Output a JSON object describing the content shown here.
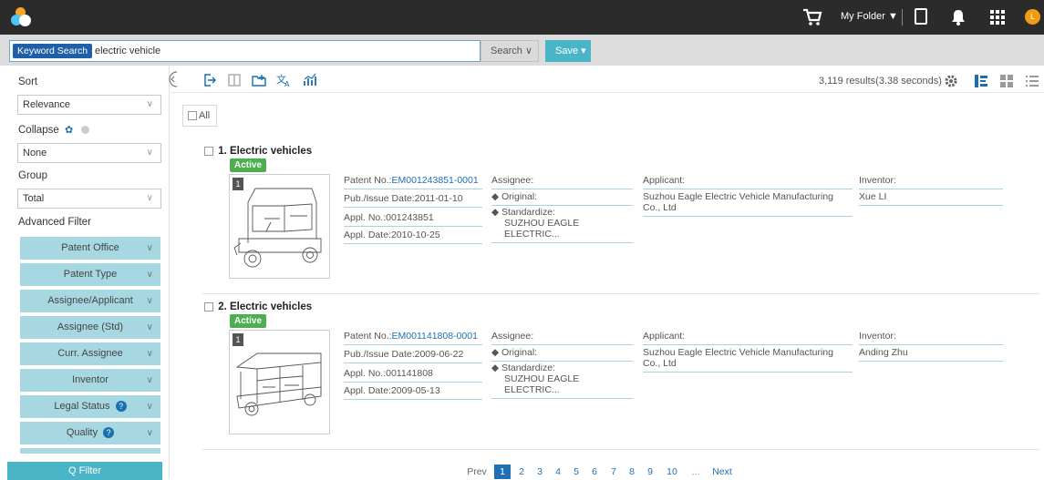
{
  "header": {
    "folder_label": "My Folder ▼",
    "avatar_letter": "L"
  },
  "search": {
    "tag": "Keyword Search",
    "query": "electric vehicle",
    "search_button": "Search ∨",
    "save_button": "Save ▾"
  },
  "sidebar": {
    "sort_label": "Sort",
    "sort_value": "Relevance",
    "collapse_label": "Collapse",
    "collapse_value": "None",
    "group_label": "Group",
    "group_value": "Total",
    "advanced_label": "Advanced Filter",
    "filters": [
      {
        "label": "Patent Office"
      },
      {
        "label": "Patent Type"
      },
      {
        "label": "Assignee/Applicant"
      },
      {
        "label": "Assignee (Std)"
      },
      {
        "label": "Curr. Assignee"
      },
      {
        "label": "Inventor"
      },
      {
        "label": "Legal Status"
      },
      {
        "label": "Quality"
      }
    ],
    "filter_button": "Q Filter"
  },
  "toolbar": {
    "results_text": "3,119 results(3.38 seconds)"
  },
  "content": {
    "all_label": "All",
    "results": [
      {
        "title": "1. Electric vehicles",
        "status": "Active",
        "image_index": "1",
        "patent_no_label": "Patent No.:",
        "patent_no": "EM001243851-0001",
        "pub_date": "Pub./Issue Date:2011-01-10",
        "appl_no": "Appl. No.:001243851",
        "appl_date": "Appl. Date:2010-10-25",
        "assignee_label": "Assignee:",
        "original_label": "◆ Original:",
        "standardize_label": "◆ Standardize:",
        "standardize_value": "SUZHOU EAGLE ELECTRIC...",
        "applicant_label": "Applicant:",
        "applicant_value": "Suzhou Eagle Electric Vehicle Manufacturing Co., Ltd",
        "inventor_label": "Inventor:",
        "inventor_value": "Xue LI"
      },
      {
        "title": "2. Electric vehicles",
        "status": "Active",
        "image_index": "1",
        "patent_no_label": "Patent No.:",
        "patent_no": "EM001141808-0001",
        "pub_date": "Pub./Issue Date:2009-06-22",
        "appl_no": "Appl. No.:001141808",
        "appl_date": "Appl. Date:2009-05-13",
        "assignee_label": "Assignee:",
        "original_label": "◆ Original:",
        "standardize_label": "◆ Standardize:",
        "standardize_value": "SUZHOU EAGLE ELECTRIC...",
        "applicant_label": "Applicant:",
        "applicant_value": "Suzhou Eagle Electric Vehicle Manufacturing Co., Ltd",
        "inventor_label": "Inventor:",
        "inventor_value": "Anding Zhu"
      }
    ]
  },
  "pagination": {
    "prev": "Prev",
    "pages": [
      "1",
      "2",
      "3",
      "4",
      "5",
      "6",
      "7",
      "8",
      "9",
      "10",
      "..."
    ],
    "next": "Next",
    "current": "1"
  },
  "colors": {
    "accent": "#4bb5c8",
    "link": "#1f6fb5",
    "active_badge": "#4caf50",
    "filter_bg": "#a7d8e2"
  }
}
